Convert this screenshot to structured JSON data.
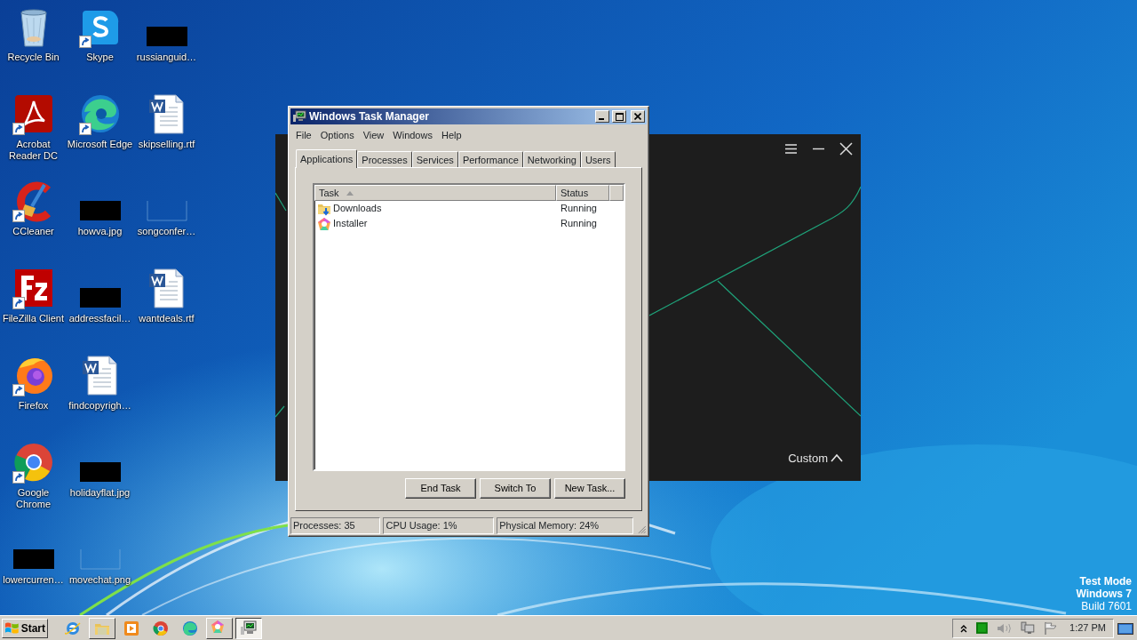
{
  "desktop": {
    "icons": [
      {
        "label": "Recycle Bin",
        "kind": "bin",
        "shortcut": false
      },
      {
        "label": "Acrobat Reader DC",
        "kind": "pdf",
        "shortcut": true
      },
      {
        "label": "CCleaner",
        "kind": "cleaner",
        "shortcut": true
      },
      {
        "label": "FileZilla Client",
        "kind": "ftp",
        "shortcut": true
      },
      {
        "label": "Firefox",
        "kind": "firefox",
        "shortcut": true
      },
      {
        "label": "Google Chrome",
        "kind": "chrome",
        "shortcut": true
      },
      {
        "label": "lowercurren…",
        "shortcut": false
      },
      {
        "label": "Skype",
        "kind": "chat",
        "shortcut": true
      },
      {
        "label": "Microsoft Edge",
        "kind": "edge",
        "shortcut": true
      },
      {
        "label": "howva.jpg",
        "shortcut": false
      },
      {
        "label": "addressfacil…",
        "shortcut": false
      },
      {
        "label": "findcopyrigh…",
        "kind": "document",
        "shortcut": false
      },
      {
        "label": "holidayflat.jpg",
        "shortcut": false
      },
      {
        "label": "movechat.png",
        "kind": "blank",
        "shortcut": false
      },
      {
        "label": "russianguid…",
        "shortcut": false
      },
      {
        "label": "skipselling.rtf",
        "kind": "document",
        "shortcut": false
      },
      {
        "label": "songconfer…",
        "kind": "blank",
        "shortcut": false
      },
      {
        "label": "wantdeals.rtf",
        "kind": "document",
        "shortcut": false
      }
    ]
  },
  "installer_window": {
    "custom_button": "Custom"
  },
  "task_manager": {
    "title": "Windows Task Manager",
    "menu": [
      "File",
      "Options",
      "View",
      "Windows",
      "Help"
    ],
    "tabs": [
      {
        "label": "Applications",
        "selected": true
      },
      {
        "label": "Processes",
        "selected": false
      },
      {
        "label": "Services",
        "selected": false
      },
      {
        "label": "Performance",
        "selected": false
      },
      {
        "label": "Networking",
        "selected": false
      },
      {
        "label": "Users",
        "selected": false
      }
    ],
    "columns": [
      {
        "label": "Task",
        "sorted": true
      },
      {
        "label": "Status",
        "sorted": false
      }
    ],
    "rows": [
      {
        "task": "Downloads",
        "kind": "folder",
        "status": "Running"
      },
      {
        "task": "Installer",
        "kind": "installer",
        "status": "Running"
      }
    ],
    "buttons": [
      "End Task",
      "Switch To",
      "New Task..."
    ],
    "status_bar": [
      "Processes: 35",
      "CPU Usage: 1%",
      "Physical Memory: 24%"
    ]
  },
  "system_notice": [
    "Test Mode",
    "Windows 7",
    "Build 7601"
  ],
  "taskbar": {
    "start": "Start",
    "buttons": [
      {
        "kind": "ie",
        "running": false,
        "selected": false
      },
      {
        "kind": "explorer",
        "running": true,
        "selected": false
      },
      {
        "kind": "media",
        "running": false,
        "selected": false
      },
      {
        "kind": "chrome",
        "running": false,
        "selected": false
      },
      {
        "kind": "edge",
        "running": false,
        "selected": false
      },
      {
        "kind": "installer",
        "running": true,
        "selected": false
      },
      {
        "kind": "taskmgr",
        "running": true,
        "selected": true
      }
    ],
    "clock": "1:27 PM"
  }
}
